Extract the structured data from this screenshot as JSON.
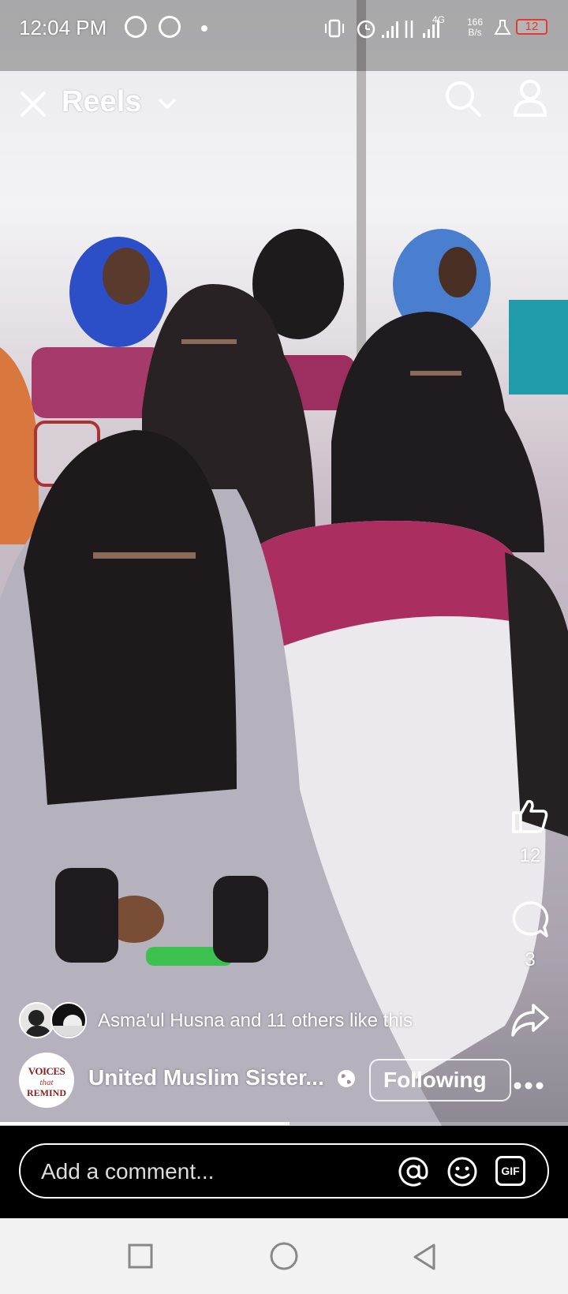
{
  "status_bar": {
    "time": "12:04 PM",
    "net_speed_value": "166",
    "net_speed_unit": "B/s",
    "network": "4G",
    "battery": "12",
    "battery_color": "#e53935"
  },
  "header": {
    "close_icon": "close-icon",
    "title": "Reels",
    "dropdown_icon": "chevron-down-icon",
    "search_icon": "search-icon",
    "profile_icon": "profile-icon"
  },
  "actions": {
    "like_icon": "thumbs-up-icon",
    "like_count": "12",
    "comment_icon": "comment-icon",
    "comment_count": "3",
    "share_icon": "share-icon"
  },
  "likes": {
    "text": "Asma'ul Husna and 11 others like this"
  },
  "page": {
    "name": "United Muslim Sister...",
    "avatar_text_1": "VOICES",
    "avatar_text_2": "that",
    "avatar_text_3": "REMIND",
    "privacy_icon": "globe-icon",
    "follow_label": "Following",
    "more_icon": "more-icon"
  },
  "playback": {
    "progress_fraction": 0.51
  },
  "comment_bar": {
    "placeholder": "Add a comment...",
    "mention_icon": "at-icon",
    "emoji_icon": "emoji-icon",
    "gif_icon": "gif-icon",
    "gif_label": "GIF"
  },
  "nav_bar": {
    "recent_icon": "square-icon",
    "home_icon": "circle-icon",
    "back_icon": "triangle-back-icon"
  }
}
